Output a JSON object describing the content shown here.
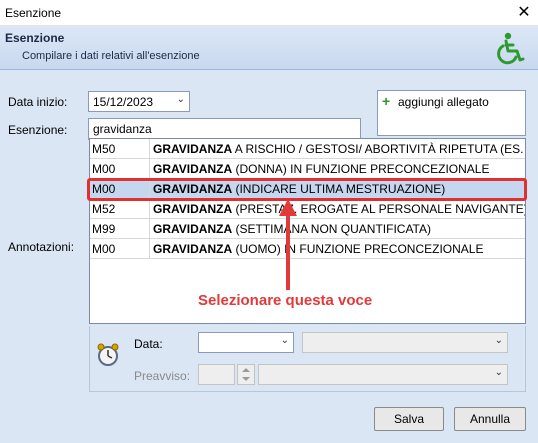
{
  "window": {
    "title": "Esenzione",
    "close_glyph": "✕"
  },
  "header": {
    "title": "Esenzione",
    "subtitle": "Compilare i dati relativi all'esenzione",
    "icon": "wheelchair-icon"
  },
  "form": {
    "data_inizio_label": "Data inizio:",
    "data_inizio_value": "15/12/2023",
    "esenzione_label": "Esenzione:",
    "esenzione_value": "gravidanza",
    "annotazioni_label": "Annotazioni:",
    "attach_label": "aggiungi allegato"
  },
  "dropdown": {
    "rows": [
      {
        "code": "M50",
        "bold": "GRAVIDANZA",
        "rest": " A RISCHIO / GESTOSI/ ABORTIVITÀ RIPETUTA (ES. SU PF"
      },
      {
        "code": "M00",
        "bold": "GRAVIDANZA",
        "rest": " (DONNA) IN FUNZIONE PRECONCEZIONALE"
      },
      {
        "code": "M00",
        "bold": "GRAVIDANZA",
        "rest": " (INDICARE ULTIMA MESTRUAZIONE)",
        "selected": true
      },
      {
        "code": "M52",
        "bold": "GRAVIDANZA",
        "rest": " (PRESTAZ. EROGATE AL PERSONALE NAVIGANTE)"
      },
      {
        "code": "M99",
        "bold": "GRAVIDANZA",
        "rest": " (SETTIMANA NON QUANTIFICATA)"
      },
      {
        "code": "M00",
        "bold": "GRAVIDANZA",
        "rest": " (UOMO) IN FUNZIONE PRECONCEZIONALE"
      }
    ]
  },
  "annotation": {
    "callout": "Selezionare questa voce",
    "color": "#e23a3a"
  },
  "reminder": {
    "icon": "alarm-clock-icon",
    "data_label": "Data:",
    "preavviso_label": "Preavviso:"
  },
  "buttons": {
    "save": "Salva",
    "cancel": "Annulla"
  }
}
